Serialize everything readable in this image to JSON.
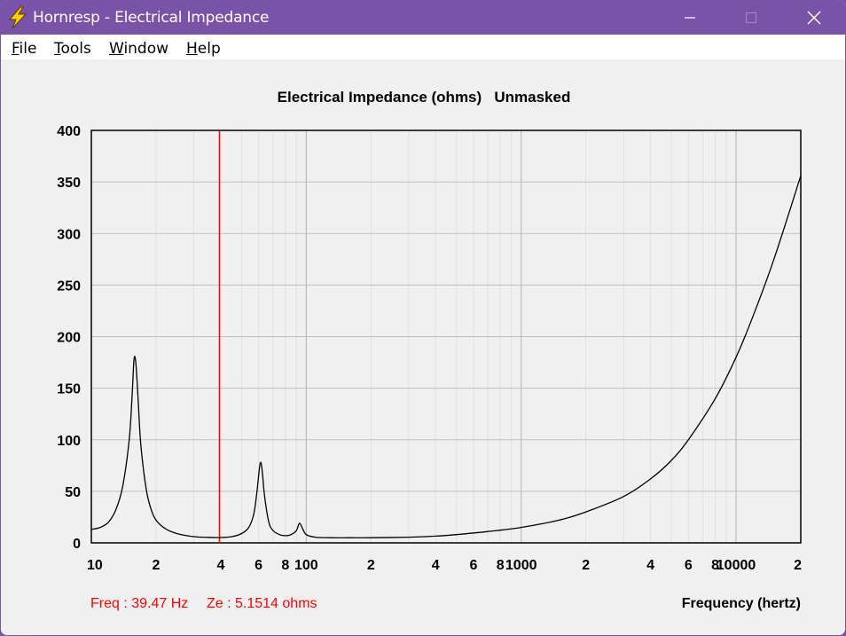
{
  "window": {
    "title": "Hornresp - Electrical Impedance",
    "icon": "lightning-bolt-icon",
    "controls": [
      "minimize-icon",
      "maximize-icon",
      "close-icon"
    ]
  },
  "menu": {
    "file": {
      "pre": "",
      "u": "F",
      "post": "ile"
    },
    "tools": {
      "pre": "",
      "u": "T",
      "post": "ools"
    },
    "window": {
      "pre": "",
      "u": "W",
      "post": "indow"
    },
    "help": {
      "pre": "",
      "u": "H",
      "post": "elp"
    }
  },
  "readout": {
    "freq": "Freq : 39.47 Hz",
    "ze": "Ze : 5.1514 ohms"
  },
  "colors": {
    "accent": "#7a52a8",
    "curve": "#000000",
    "cursor": "#ff0000",
    "grid_major": "#bfbfbf",
    "grid_minor": "#e0e0e0"
  },
  "chart_data": {
    "type": "line",
    "title": "Electrical Impedance (ohms)   Unmasked",
    "xlabel": "Frequency (hertz)",
    "ylabel": "",
    "xscale": "log",
    "xlim": [
      10,
      20000
    ],
    "ylim": [
      0,
      400
    ],
    "grid": true,
    "y_ticks": [
      400,
      350,
      300,
      250,
      200,
      150,
      100,
      50,
      0
    ],
    "x_ticks": [
      {
        "value": 10,
        "label": "10"
      },
      {
        "value": 20,
        "label": "2"
      },
      {
        "value": 40,
        "label": "4"
      },
      {
        "value": 60,
        "label": "6"
      },
      {
        "value": 80,
        "label": "8"
      },
      {
        "value": 100,
        "label": "100"
      },
      {
        "value": 200,
        "label": "2"
      },
      {
        "value": 400,
        "label": "4"
      },
      {
        "value": 600,
        "label": "6"
      },
      {
        "value": 800,
        "label": "8"
      },
      {
        "value": 1000,
        "label": "1000"
      },
      {
        "value": 2000,
        "label": "2"
      },
      {
        "value": 4000,
        "label": "4"
      },
      {
        "value": 6000,
        "label": "6"
      },
      {
        "value": 8000,
        "label": "8"
      },
      {
        "value": 10000,
        "label": "10000"
      },
      {
        "value": 20000,
        "label": "2"
      }
    ],
    "cursor_x": 39.47,
    "series": [
      {
        "name": "",
        "x": [
          10,
          11,
          12,
          13,
          14,
          15,
          15.5,
          15.8,
          16.1,
          16.5,
          17,
          18,
          19,
          20,
          22,
          25,
          30,
          35,
          39.47,
          45,
          50,
          54,
          57,
          59,
          60.5,
          61.5,
          62.5,
          64,
          67,
          70,
          75,
          80,
          85,
          90,
          93,
          96,
          100,
          110,
          130,
          160,
          200,
          300,
          400,
          500,
          700,
          1000,
          1500,
          2000,
          3000,
          4000,
          5000,
          6000,
          8000,
          10000,
          12000,
          15000,
          20000
        ],
        "y": [
          13,
          15,
          20,
          32,
          55,
          100,
          145,
          178,
          175,
          140,
          95,
          52,
          32,
          22,
          14,
          9,
          6,
          5.3,
          5.2,
          6,
          9,
          15,
          28,
          50,
          72,
          78,
          68,
          45,
          20,
          12,
          8,
          7,
          8,
          12,
          19,
          14,
          8,
          5.5,
          5,
          5,
          5,
          5.5,
          6.5,
          8,
          11,
          15,
          22,
          30,
          45,
          62,
          80,
          100,
          140,
          180,
          220,
          275,
          356
        ]
      }
    ]
  }
}
